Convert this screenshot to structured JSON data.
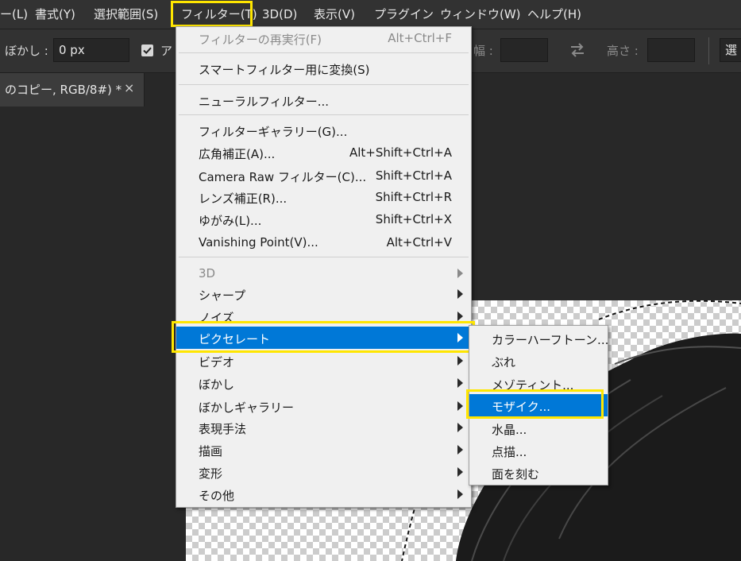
{
  "menubar": {
    "items": [
      "ー(L)",
      "書式(Y)",
      "選択範囲(S)",
      "フィルター(T)",
      "3D(D)",
      "表示(V)",
      "プラグイン",
      "ウィンドウ(W)",
      "ヘルプ(H)"
    ]
  },
  "options": {
    "blur_label": "ぼかし :",
    "blur_value": "0 px",
    "antialias_label": "ア",
    "width_label": "幅 :",
    "height_label": "高さ :",
    "select_label": "選"
  },
  "tab": {
    "title": "のコピー, RGB/8#) *",
    "close": "×"
  },
  "filter_menu": {
    "items": [
      {
        "label": "フィルターの再実行(F)",
        "shortcut": "Alt+Ctrl+F",
        "disabled": true
      },
      {
        "label": "スマートフィルター用に変換(S)",
        "shortcut": ""
      },
      {
        "label": "ニューラルフィルター...",
        "shortcut": ""
      },
      {
        "label": "フィルターギャラリー(G)...",
        "shortcut": ""
      },
      {
        "label": "広角補正(A)...",
        "shortcut": "Alt+Shift+Ctrl+A"
      },
      {
        "label": "Camera Raw フィルター(C)...",
        "shortcut": "Shift+Ctrl+A"
      },
      {
        "label": "レンズ補正(R)...",
        "shortcut": "Shift+Ctrl+R"
      },
      {
        "label": "ゆがみ(L)...",
        "shortcut": "Shift+Ctrl+X"
      },
      {
        "label": "Vanishing Point(V)...",
        "shortcut": "Alt+Ctrl+V"
      },
      {
        "label": "3D",
        "submenu": true,
        "disabled": true
      },
      {
        "label": "シャープ",
        "submenu": true
      },
      {
        "label": "ノイズ",
        "submenu": true
      },
      {
        "label": "ピクセレート",
        "submenu": true,
        "highlighted": true
      },
      {
        "label": "ビデオ",
        "submenu": true
      },
      {
        "label": "ぼかし",
        "submenu": true
      },
      {
        "label": "ぼかしギャラリー",
        "submenu": true
      },
      {
        "label": "表現手法",
        "submenu": true
      },
      {
        "label": "描画",
        "submenu": true
      },
      {
        "label": "変形",
        "submenu": true
      },
      {
        "label": "その他",
        "submenu": true
      }
    ]
  },
  "pixelate_submenu": {
    "items": [
      {
        "label": "カラーハーフトーン..."
      },
      {
        "label": "ぶれ"
      },
      {
        "label": "メゾティント..."
      },
      {
        "label": "モザイク...",
        "highlighted": true
      },
      {
        "label": "水晶..."
      },
      {
        "label": "点描..."
      },
      {
        "label": "面を刻む"
      }
    ]
  },
  "colors": {
    "highlight_blue": "#0078d7",
    "annotation_yellow": "#ffe600",
    "menu_bg": "#f0f0f0",
    "chrome_bg": "#323232"
  }
}
